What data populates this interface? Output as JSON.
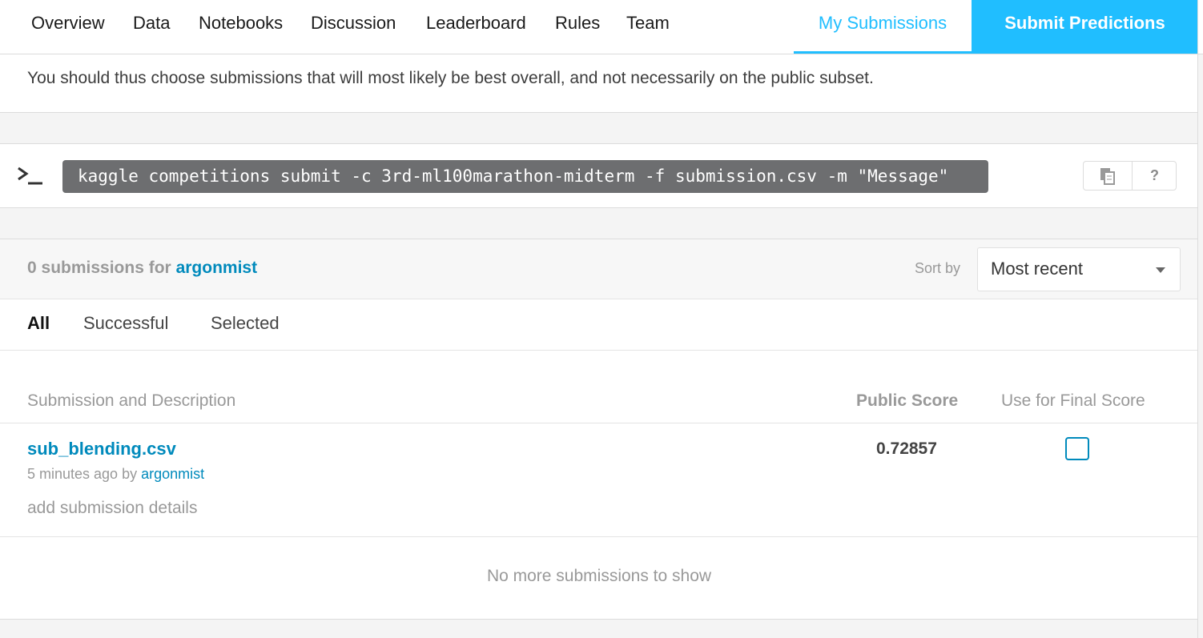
{
  "nav": {
    "tabs": [
      "Overview",
      "Data",
      "Notebooks",
      "Discussion",
      "Leaderboard",
      "Rules",
      "Team"
    ],
    "my_submissions": "My Submissions",
    "submit_predictions": "Submit Predictions",
    "active_color": "#20beff"
  },
  "info": {
    "text": "You should thus choose submissions that will most likely be best overall, and not necessarily on the public subset."
  },
  "cli": {
    "prompt_icon": "terminal-icon",
    "command": "kaggle competitions submit -c 3rd-ml100marathon-midterm -f submission.csv -m \"Message\"",
    "copy_icon": "copy-icon",
    "help_label": "?"
  },
  "submissions": {
    "count_text": "0 submissions for",
    "user": "argonmist",
    "sort_label": "Sort by",
    "sort_value": "Most recent",
    "filters": [
      "All",
      "Successful",
      "Selected"
    ],
    "active_filter": "All",
    "columns": {
      "submission": "Submission and Description",
      "public_score": "Public Score",
      "final": "Use for Final Score"
    },
    "rows": [
      {
        "file": "sub_blending.csv",
        "time": "5 minutes ago by",
        "by": "argonmist",
        "details": "add submission details",
        "score": "0.72857",
        "selected": false
      }
    ],
    "footer": "No more submissions to show",
    "link_color": "#008abc"
  }
}
